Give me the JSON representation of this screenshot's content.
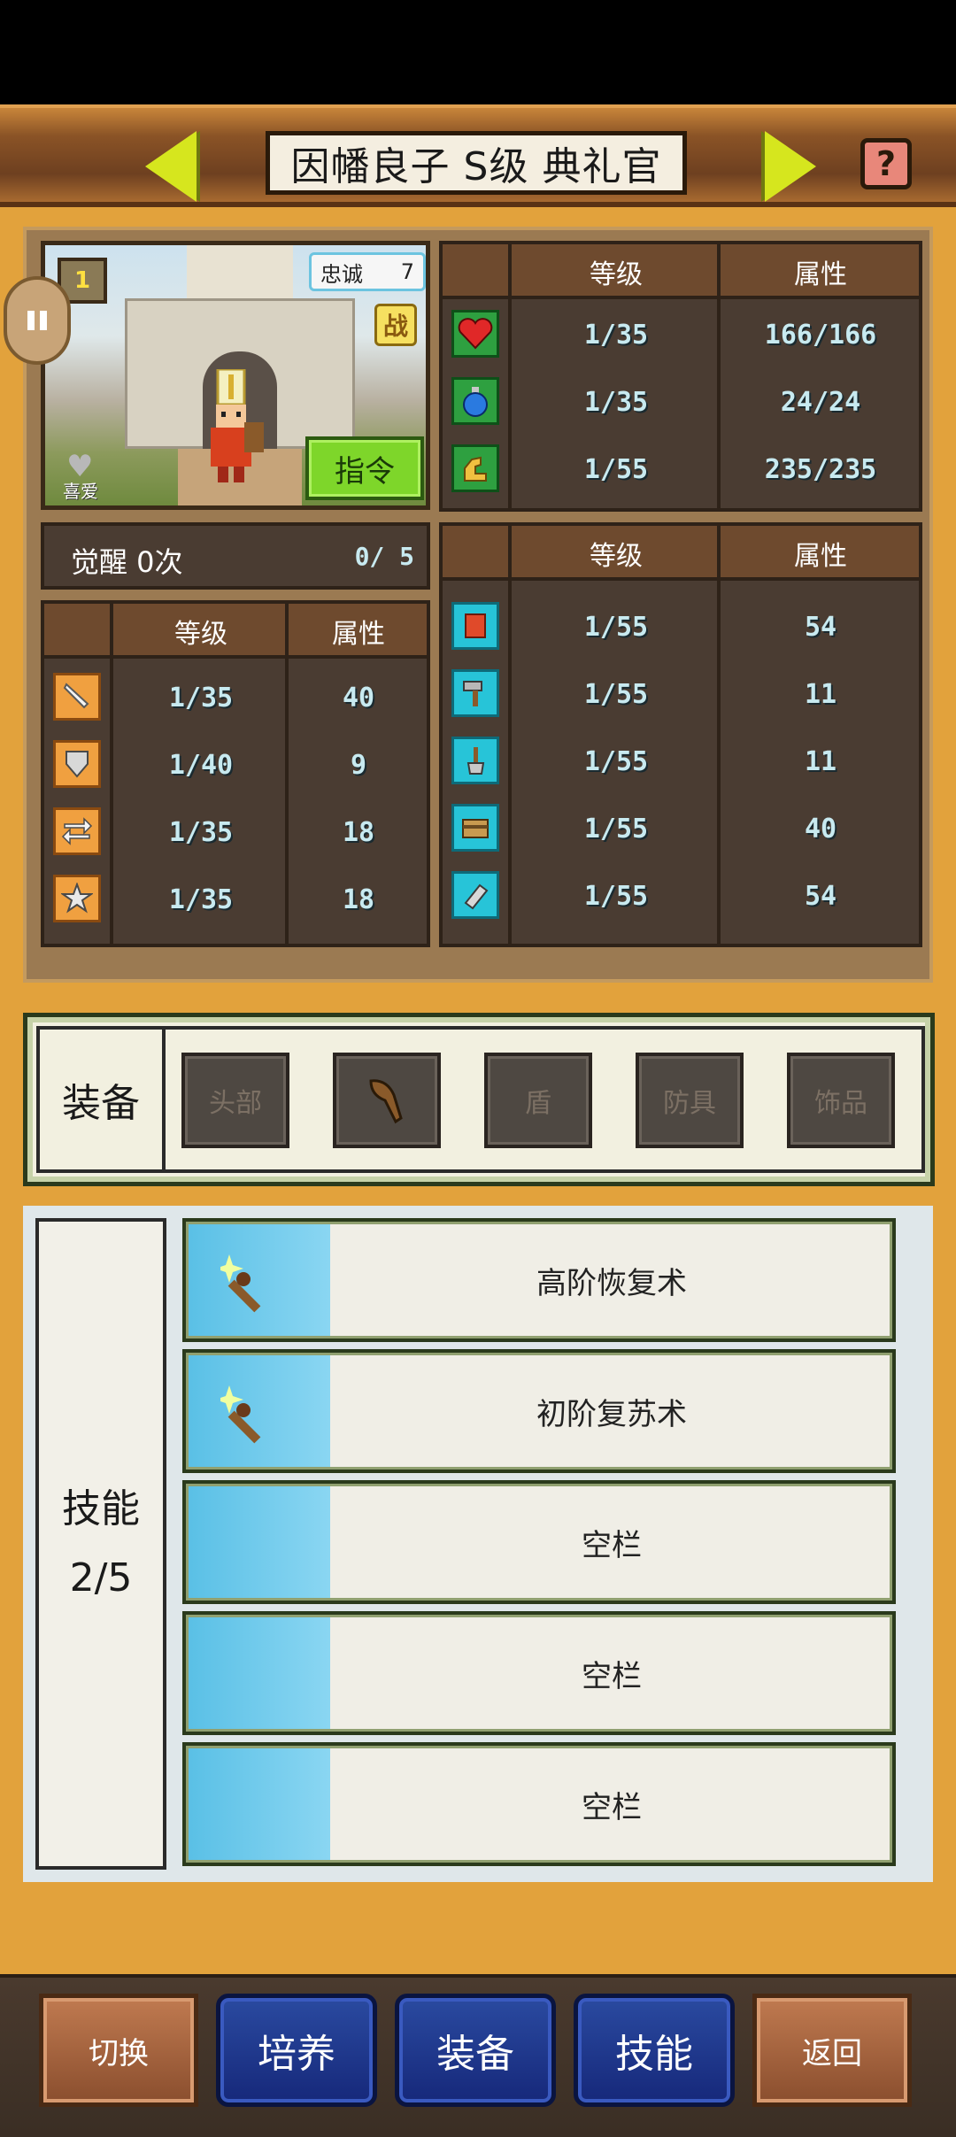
{
  "header": {
    "title": "因幡良子 S级 典礼官",
    "prev_icon": "left-arrow-icon",
    "next_icon": "right-arrow-icon",
    "help_icon": "question-mark-icon",
    "help_glyph": "?"
  },
  "portrait": {
    "level_badge": "1",
    "loyalty_label": "忠诚",
    "loyalty_value": "7",
    "battle_badge": "战",
    "like_label": "喜爱",
    "command_button": "指令"
  },
  "vitals_table": {
    "headers": [
      "等级",
      "属性"
    ],
    "rows": [
      {
        "icon": "heart-icon",
        "level": "1/35",
        "value": "166/166"
      },
      {
        "icon": "potion-icon",
        "level": "1/35",
        "value": "24/24"
      },
      {
        "icon": "strength-arm-icon",
        "level": "1/55",
        "value": "235/235"
      }
    ]
  },
  "awaken": {
    "label": "觉醒 0次",
    "progress": "0/ 5"
  },
  "combat_table": {
    "headers": [
      "等级",
      "属性"
    ],
    "rows": [
      {
        "icon": "sword-icon",
        "level": "1/35",
        "value": "40"
      },
      {
        "icon": "shield-icon",
        "level": "1/40",
        "value": "9"
      },
      {
        "icon": "speed-arrows-icon",
        "level": "1/35",
        "value": "18"
      },
      {
        "icon": "star-icon",
        "level": "1/35",
        "value": "18"
      }
    ]
  },
  "craft_table": {
    "headers": [
      "等级",
      "属性"
    ],
    "rows": [
      {
        "icon": "book-icon",
        "level": "1/55",
        "value": "54"
      },
      {
        "icon": "hammer-icon",
        "level": "1/55",
        "value": "11"
      },
      {
        "icon": "shovel-icon",
        "level": "1/55",
        "value": "11"
      },
      {
        "icon": "chest-icon",
        "level": "1/55",
        "value": "40"
      },
      {
        "icon": "scroll-icon",
        "level": "1/55",
        "value": "54"
      }
    ]
  },
  "equipment": {
    "label": "装备",
    "slots": [
      {
        "label": "头部",
        "filled": false
      },
      {
        "label": "",
        "filled": true,
        "icon": "club-icon"
      },
      {
        "label": "盾",
        "filled": false
      },
      {
        "label": "防具",
        "filled": false
      },
      {
        "label": "饰品",
        "filled": false
      }
    ]
  },
  "skills": {
    "label": "技能",
    "count": "2/5",
    "items": [
      {
        "name": "高阶恢复术",
        "icon": "magic-wand-icon"
      },
      {
        "name": "初阶复苏术",
        "icon": "magic-wand-icon"
      },
      {
        "name": "空栏",
        "icon": ""
      },
      {
        "name": "空栏",
        "icon": ""
      },
      {
        "name": "空栏",
        "icon": ""
      }
    ]
  },
  "bottom_nav": {
    "switch": "切换",
    "train": "培养",
    "equip": "装备",
    "skill": "技能",
    "back": "返回"
  }
}
